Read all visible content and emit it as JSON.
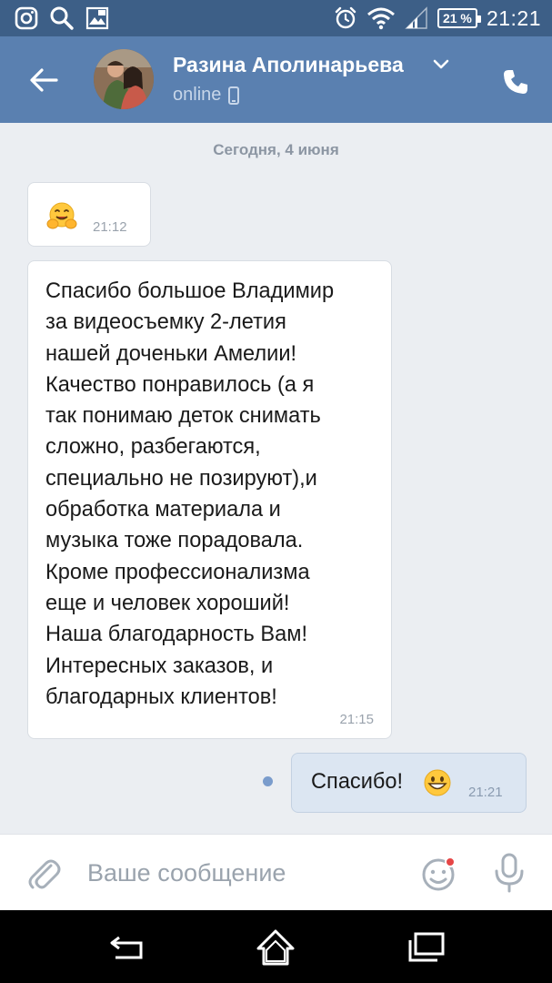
{
  "status_bar": {
    "battery_percent": "21 %",
    "time": "21:21"
  },
  "header": {
    "contact_name": "Разина Аполинарьева",
    "presence": "online"
  },
  "chat": {
    "date_separator": "Сегодня, 4 июня",
    "messages": [
      {
        "direction": "incoming",
        "emoji": "hugging-face",
        "text": "",
        "time": "21:12"
      },
      {
        "direction": "incoming",
        "text": "Спасибо большое Владимир\nза видеосъемку 2-летия\nнашей доченьки Амелии!\nКачество понравилось (а я\nтак понимаю деток снимать\nсложно, разбегаются,\nспециально не позируют),и\nобработка материала и\nмузыка тоже порадовала.\nКроме профессионализма\nеще и человек хороший!\nНаша благодарность Вам!\nИнтересных заказов, и\nблагодарных клиентов!",
        "time": "21:15"
      },
      {
        "direction": "outgoing",
        "text": "Спасибо!",
        "emoji": "grinning-face",
        "time": "21:21",
        "unread": true
      }
    ]
  },
  "composer": {
    "placeholder": "Ваше сообщение",
    "value": ""
  },
  "colors": {
    "status_bar": "#3d5f87",
    "header": "#5a80b0",
    "chat_background": "#ebeef2",
    "outgoing_bubble": "#dce6f2",
    "incoming_bubble": "#ffffff"
  }
}
